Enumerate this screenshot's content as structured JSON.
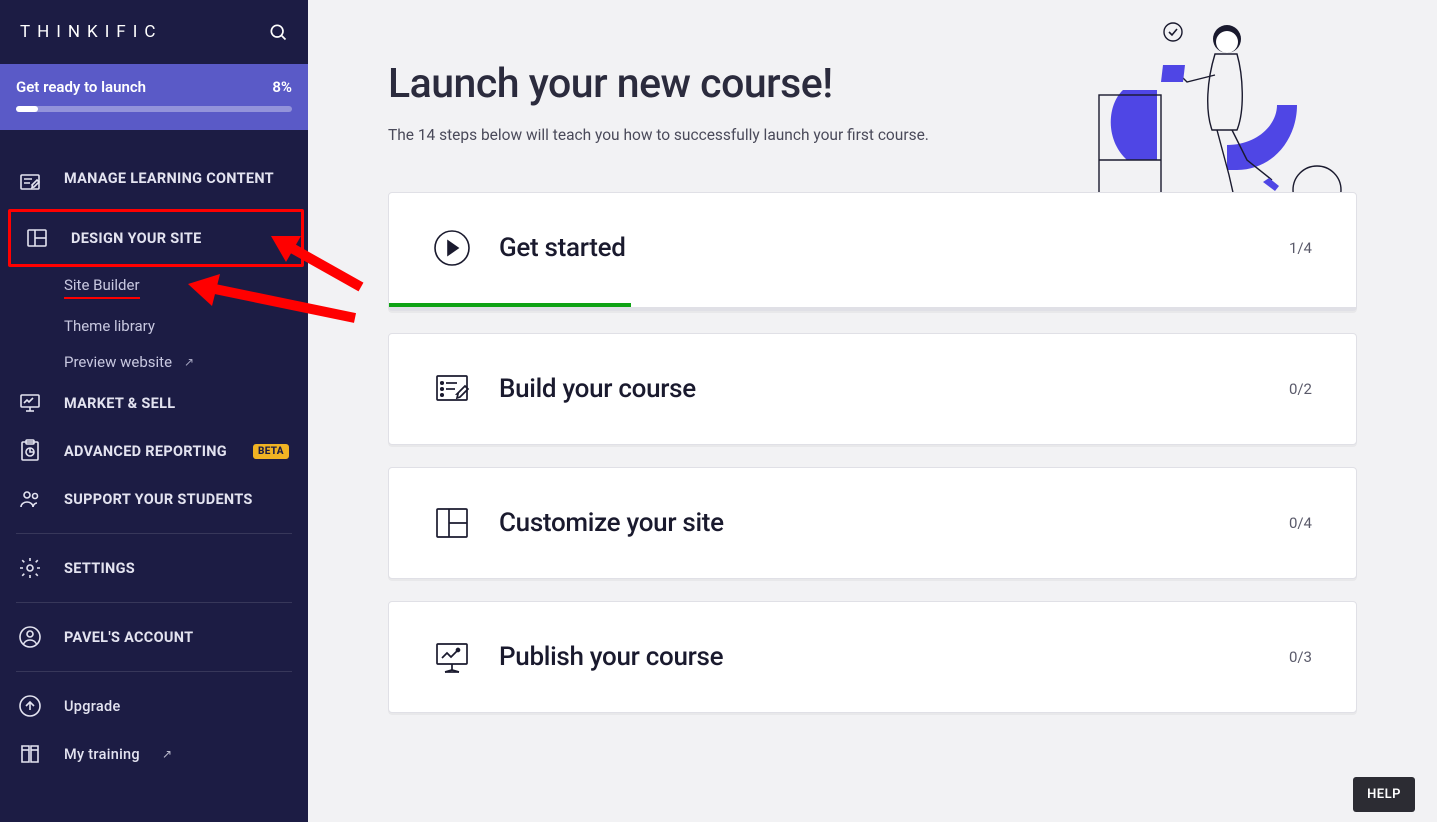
{
  "brand": "THINKIFIC",
  "launch_banner": {
    "label": "Get ready to launch",
    "percent": "8%"
  },
  "sidebar": {
    "manage_learning": "MANAGE LEARNING CONTENT",
    "design_site": "DESIGN YOUR SITE",
    "sub_site_builder": "Site Builder",
    "sub_theme_library": "Theme library",
    "sub_preview_website": "Preview website",
    "market_sell": "MARKET & SELL",
    "advanced_reporting": "ADVANCED REPORTING",
    "beta": "BETA",
    "support_students": "SUPPORT YOUR STUDENTS",
    "settings": "SETTINGS",
    "account": "PAVEL'S ACCOUNT",
    "upgrade": "Upgrade",
    "my_training": "My training"
  },
  "page": {
    "title": "Launch your new course!",
    "subtitle": "The 14 steps below will teach you how to successfully launch your first course."
  },
  "cards": {
    "get_started": {
      "title": "Get started",
      "count": "1/4"
    },
    "build_course": {
      "title": "Build your course",
      "count": "0/2"
    },
    "customize_site": {
      "title": "Customize your site",
      "count": "0/4"
    },
    "publish_course": {
      "title": "Publish your course",
      "count": "0/3"
    }
  },
  "help": "HELP"
}
